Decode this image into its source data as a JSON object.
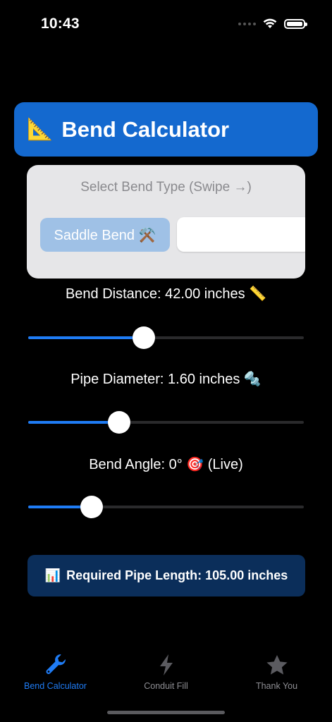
{
  "status_bar": {
    "time": "10:43"
  },
  "header": {
    "icon": "📐",
    "title": "Bend Calculator",
    "color": "#1469cf"
  },
  "bend_type": {
    "heading": "Select Bend Type (Swipe →)",
    "options": [
      {
        "label": "Saddle Bend ⚒️",
        "selected": true
      },
      {
        "label": ""
      }
    ]
  },
  "sliders": {
    "bend_distance": {
      "label": "Bend Distance: 42.00 inches 📏",
      "value": 42.0,
      "fraction": 0.42
    },
    "pipe_diameter": {
      "label": "Pipe Diameter: 1.60 inches 🔩",
      "value": 1.6,
      "fraction": 0.33
    },
    "bend_angle": {
      "label": "Bend Angle: 0° 🎯 (Live)",
      "value": 0,
      "fraction": 0.23
    }
  },
  "result": {
    "icon": "📊",
    "text": "Required Pipe Length: 105.00 inches"
  },
  "tabs": [
    {
      "label": "Bend Calculator",
      "icon": "wrench-icon",
      "active": true
    },
    {
      "label": "Conduit Fill",
      "icon": "bolt-icon",
      "active": false
    },
    {
      "label": "Thank You",
      "icon": "star-icon",
      "active": false
    }
  ],
  "colors": {
    "accent": "#1f7cf5",
    "result_bg": "#0b2e5a",
    "card_bg": "#e6e6e8"
  }
}
